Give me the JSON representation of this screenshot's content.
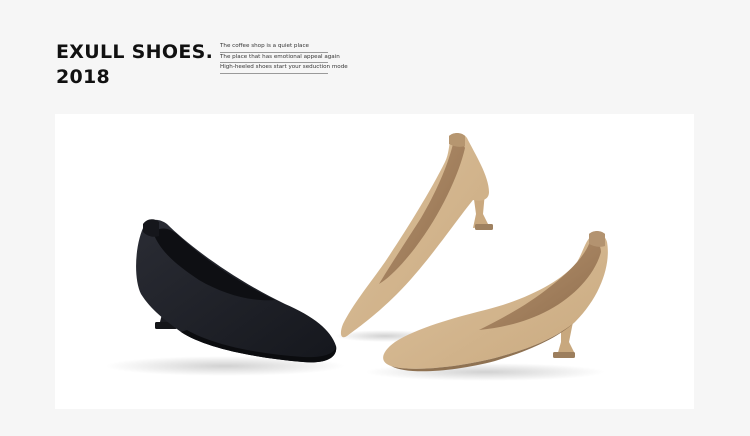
{
  "brand": {
    "title_line1": "EXULL SHOES.",
    "title_line2": "2018"
  },
  "taglines": [
    "The coffee shop is a quiet place",
    "The place that has emotional appeal again",
    "High-heeled shoes start your seduction mode"
  ],
  "colors": {
    "page_background": "#f6f6f6",
    "photo_background": "#ffffff",
    "black_suede": "#1d1f26",
    "beige_suede": "#d6b892",
    "beige_shadow": "#b79a74"
  },
  "photo": {
    "subject": "product-photo-pumps"
  }
}
